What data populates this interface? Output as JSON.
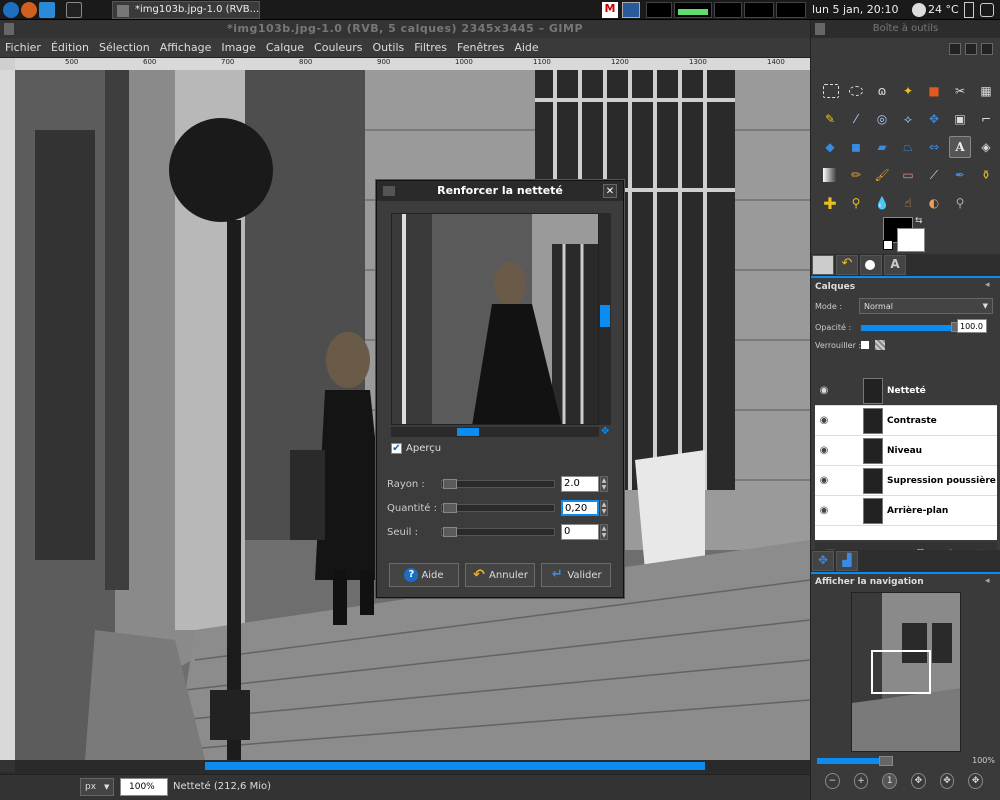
{
  "taskbar": {
    "task_title": "*img103b.jpg-1.0 (RVB...",
    "clock": "lun 5 jan, 20:10",
    "temperature": "24 °C"
  },
  "window": {
    "title": "*img103b.jpg-1.0 (RVB, 5 calques) 2345x3445 – GIMP"
  },
  "menubar": {
    "items": [
      "Fichier",
      "Édition",
      "Sélection",
      "Affichage",
      "Image",
      "Calque",
      "Couleurs",
      "Outils",
      "Filtres",
      "Fenêtres",
      "Aide"
    ]
  },
  "rulers": {
    "top_ticks": [
      "500",
      "600",
      "700",
      "800",
      "900",
      "1000",
      "1100",
      "1200",
      "1300",
      "1400"
    ]
  },
  "statusbar": {
    "unit": "px",
    "zoom": "100%",
    "status_text": "Netteté (212,6 Mio)"
  },
  "dialog": {
    "title": "Renforcer la netteté",
    "preview_label": "Aperçu",
    "preview_checked": true,
    "params": [
      {
        "label": "Rayon :",
        "value": "2.0"
      },
      {
        "label": "Quantité :",
        "value": "0,20"
      },
      {
        "label": "Seuil :",
        "value": "0"
      }
    ],
    "buttons": {
      "help": "Aide",
      "cancel": "Annuler",
      "ok": "Valider"
    }
  },
  "dock": {
    "title": "Boîte à outils",
    "layers_section": "Calques",
    "mode_label": "Mode :",
    "mode_value": "Normal",
    "opacity_label": "Opacité :",
    "opacity_value": "100.0",
    "lock_label": "Verrouiller :",
    "layers": [
      "Netteté",
      "Contraste",
      "Niveau",
      "Supression poussière",
      "Arrière-plan"
    ],
    "navigation_section": "Afficher la navigation",
    "nav_zoom": "100%"
  },
  "colors": {
    "accent": "#0a8cf0",
    "fg_color": "#000000",
    "bg_color": "#ffffff"
  }
}
